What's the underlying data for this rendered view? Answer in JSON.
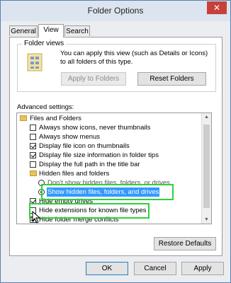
{
  "window": {
    "title": "Folder Options",
    "close_glyph": "✕"
  },
  "tabs": [
    "General",
    "View",
    "Search"
  ],
  "folder_views": {
    "legend": "Folder views",
    "description": "You can apply this view (such as Details or Icons) to all folders of this type.",
    "apply_button": "Apply to Folders",
    "reset_button": "Reset Folders"
  },
  "advanced": {
    "label": "Advanced settings:",
    "items": [
      {
        "type": "folder",
        "label": "Files and Folders"
      },
      {
        "type": "checkbox",
        "label": "Always show icons, never thumbnails",
        "checked": false
      },
      {
        "type": "checkbox",
        "label": "Always show menus",
        "checked": false
      },
      {
        "type": "checkbox",
        "label": "Display file icon on thumbnails",
        "checked": true
      },
      {
        "type": "checkbox",
        "label": "Display file size information in folder tips",
        "checked": true
      },
      {
        "type": "checkbox",
        "label": "Display the full path in the title bar",
        "checked": false
      },
      {
        "type": "folder",
        "label": "Hidden files and folders"
      },
      {
        "type": "radio",
        "label": "Don't show hidden files, folders, or drives",
        "checked": false
      },
      {
        "type": "radio",
        "label": "Show hidden files, folders, and drives",
        "checked": true,
        "selected": true
      },
      {
        "type": "checkbox",
        "label": "Hide empty drives",
        "checked": true
      },
      {
        "type": "checkbox",
        "label": "Hide extensions for known file types",
        "checked": false
      },
      {
        "type": "checkbox",
        "label": "Hide folder merge conflicts",
        "checked": true
      }
    ]
  },
  "restore_button": "Restore Defaults",
  "footer": {
    "ok": "OK",
    "cancel": "Cancel",
    "apply": "Apply"
  },
  "colors": {
    "highlight": "#2fd13a",
    "selection": "#3399ff"
  }
}
